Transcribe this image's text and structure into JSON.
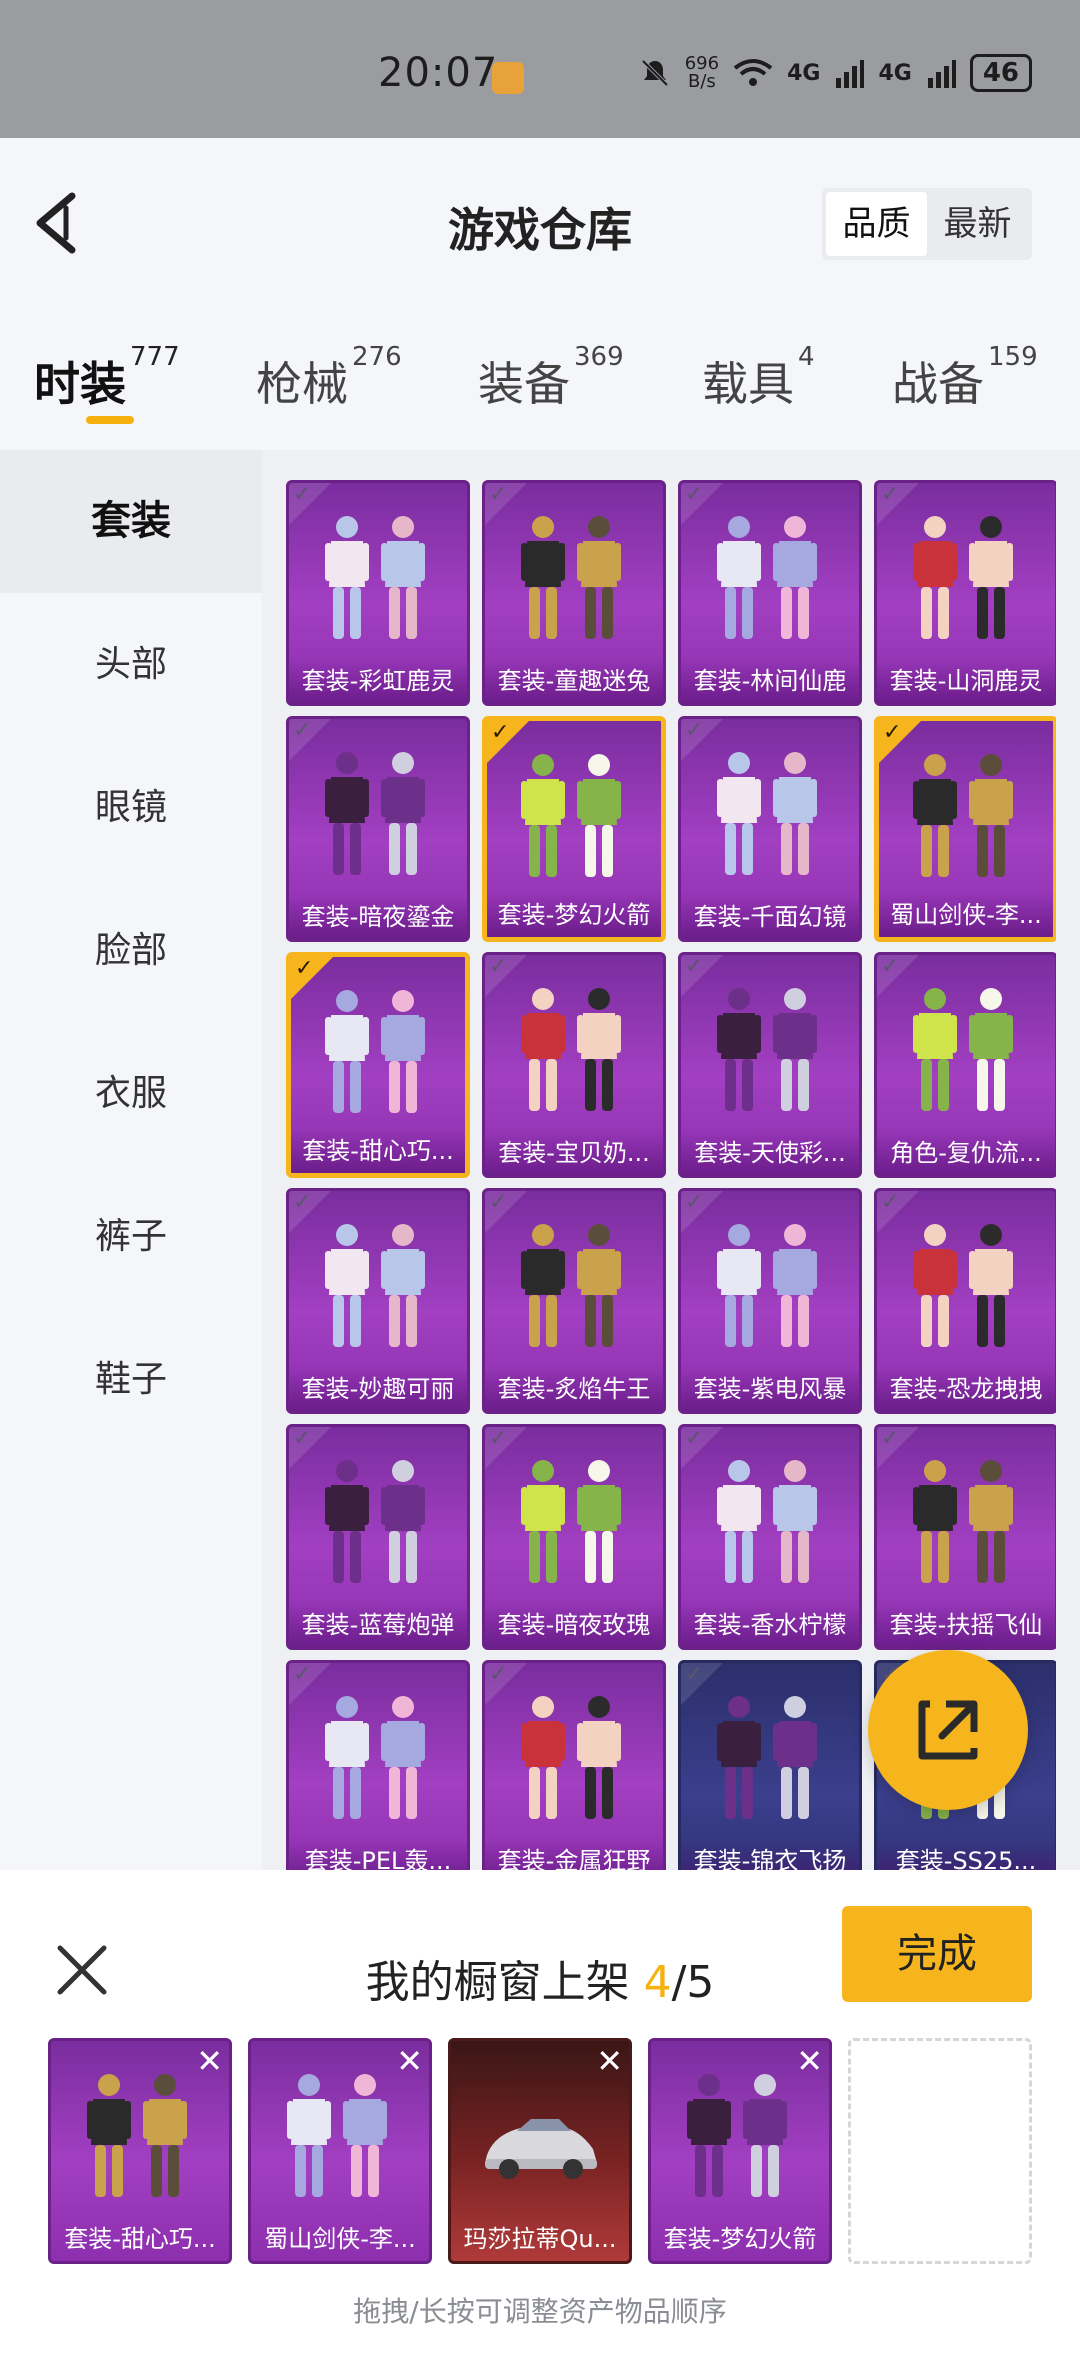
{
  "status_bar": {
    "time": "20:07",
    "net_speed": "696",
    "net_unit": "B/s",
    "signal1": "4G",
    "signal2": "4G",
    "battery": "46"
  },
  "header": {
    "title": "游戏仓库",
    "sort_options": [
      "品质",
      "最新"
    ],
    "active_sort": "品质"
  },
  "tabs": [
    {
      "label": "时装",
      "count": "777"
    },
    {
      "label": "枪械",
      "count": "276"
    },
    {
      "label": "装备",
      "count": "369"
    },
    {
      "label": "载具",
      "count": "4"
    },
    {
      "label": "战备",
      "count": "159"
    }
  ],
  "sidebar": [
    "套装",
    "头部",
    "眼镜",
    "脸部",
    "衣服",
    "裤子",
    "鞋子"
  ],
  "items": [
    {
      "label": "套装-彩虹鹿灵",
      "selected": false
    },
    {
      "label": "套装-童趣迷兔",
      "selected": false
    },
    {
      "label": "套装-林间仙鹿",
      "selected": false
    },
    {
      "label": "套装-山洞鹿灵",
      "selected": false
    },
    {
      "label": "套装-暗夜鎏金",
      "selected": false
    },
    {
      "label": "套装-梦幻火箭",
      "selected": true
    },
    {
      "label": "套装-千面幻镜",
      "selected": false
    },
    {
      "label": "蜀山剑侠-李...",
      "selected": true
    },
    {
      "label": "套装-甜心巧...",
      "selected": true
    },
    {
      "label": "套装-宝贝奶...",
      "selected": false
    },
    {
      "label": "套装-天使彩...",
      "selected": false
    },
    {
      "label": "角色-复仇流...",
      "selected": false
    },
    {
      "label": "套装-妙趣可丽",
      "selected": false
    },
    {
      "label": "套装-炙焰牛王",
      "selected": false
    },
    {
      "label": "套装-紫电风暴",
      "selected": false
    },
    {
      "label": "套装-恐龙拽拽",
      "selected": false
    },
    {
      "label": "套装-蓝莓炮弹",
      "selected": false
    },
    {
      "label": "套装-暗夜玫瑰",
      "selected": false
    },
    {
      "label": "套装-香水柠檬",
      "selected": false
    },
    {
      "label": "套装-扶摇飞仙",
      "selected": false
    },
    {
      "label": "套装-PEL轰...",
      "selected": false
    },
    {
      "label": "套装-金属狂野",
      "selected": false
    },
    {
      "label": "套装-锦衣飞扬",
      "selected": false,
      "style": "blue"
    },
    {
      "label": "套装-SS25...",
      "selected": false,
      "style": "blue"
    }
  ],
  "panel": {
    "title_prefix": "我的橱窗上架",
    "current": "4",
    "total": "/5",
    "done_label": "完成",
    "slots": [
      {
        "label": "套装-甜心巧...",
        "style": "purple"
      },
      {
        "label": "蜀山剑侠-李...",
        "style": "purple"
      },
      {
        "label": "玛莎拉蒂Qu...",
        "style": "red"
      },
      {
        "label": "套装-梦幻火箭",
        "style": "purple"
      }
    ],
    "hint": "拖拽/长按可调整资产物品顺序"
  },
  "colors": {
    "accent": "#f6b51c",
    "card_purple": "#9b3bbd",
    "card_blue": "#3b3f8d"
  }
}
